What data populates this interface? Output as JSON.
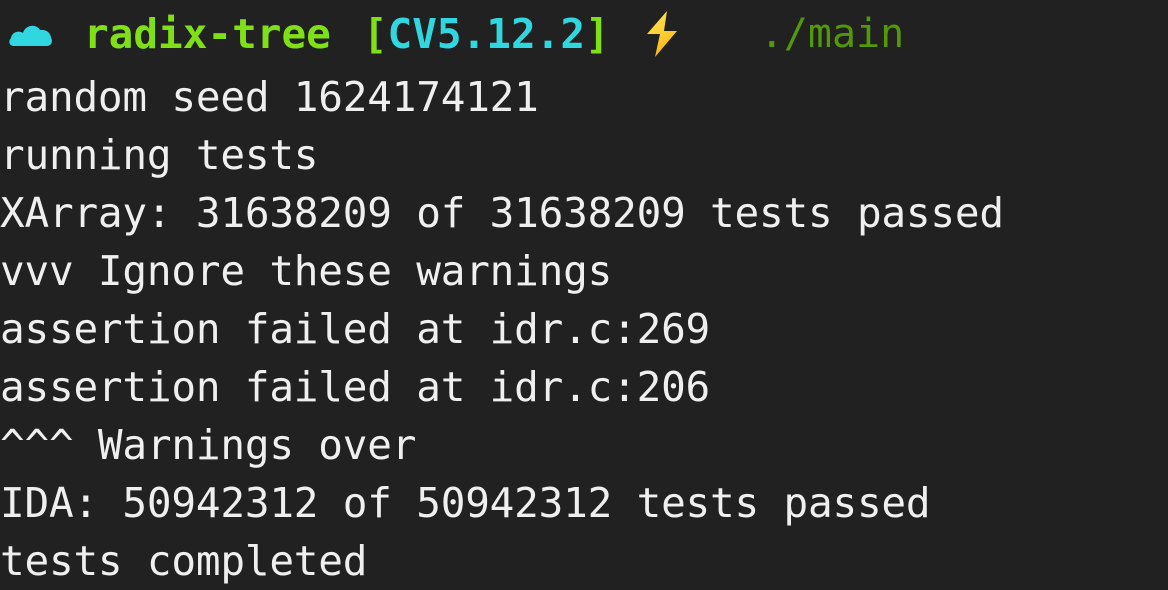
{
  "terminal": {
    "background_color": "#212121",
    "text_color": "#efefef",
    "prompt": {
      "cloud_icon_name": "cloud-icon",
      "cloud_icon_color": "#30d7e0",
      "project": "radix-tree",
      "project_color": "#7fe018",
      "bracket_open": "[",
      "bracket_close": "]",
      "bracket_color": "#7fe018",
      "version": "CV5.12.2",
      "version_color": "#30d7e0",
      "bolt_icon_name": "lightning-bolt-icon",
      "bolt_icon_color": "#fbc02d",
      "command": "./main",
      "command_color": "#53970a"
    },
    "output_lines": [
      "random seed 1624174121",
      "running tests",
      "XArray: 31638209 of 31638209 tests passed",
      "vvv Ignore these warnings",
      "assertion failed at idr.c:269",
      "assertion failed at idr.c:206",
      "^^^ Warnings over",
      "IDA: 50942312 of 50942312 tests passed",
      "tests completed"
    ]
  }
}
